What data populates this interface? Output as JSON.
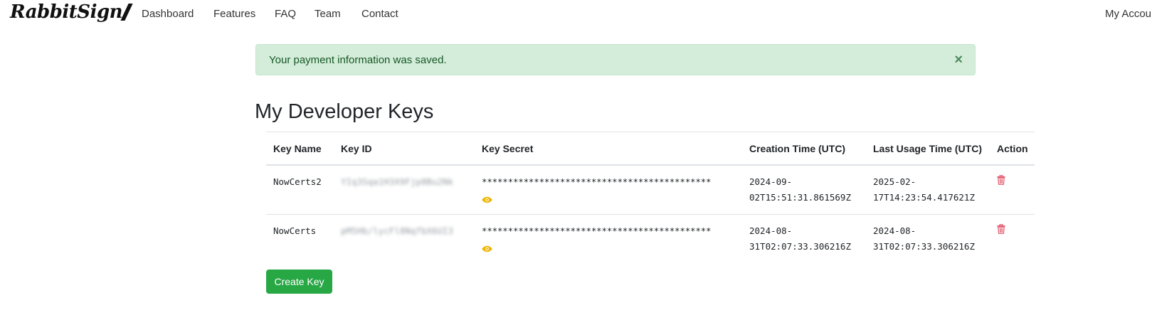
{
  "nav": {
    "brand": "RabbitSign",
    "links": [
      "Dashboard",
      "Features",
      "FAQ",
      "Team",
      "Contact"
    ],
    "account": "My Account"
  },
  "alert": {
    "message": "Your payment information was saved.",
    "close": "×",
    "colors": {
      "background": "#d4edda",
      "text": "#155724"
    }
  },
  "page": {
    "title": "My Developer Keys"
  },
  "table": {
    "headers": [
      "Key Name",
      "Key ID",
      "Key Secret",
      "Creation Time (UTC)",
      "Last Usage Time (UTC)",
      "Action"
    ],
    "rows": [
      {
        "name": "NowCerts2",
        "key_id": "YIq3Sqa1H3X9Fjp8Bu2Nk",
        "secret": "********************************************",
        "reveal_icon": "eye-icon",
        "created_line1": "2024-09-",
        "created_line2": "02T15:51:31.861569Z",
        "last_used_line1": "2025-02-",
        "last_used_line2": "17T14:23:54.417621Z",
        "action_icon": "trash-icon"
      },
      {
        "name": "NowCerts",
        "key_id": "pM5Hb/lycFl8NqfbX6UI3",
        "secret": "********************************************",
        "reveal_icon": "eye-icon",
        "created_line1": "2024-08-",
        "created_line2": "31T02:07:33.306216Z",
        "last_used_line1": "2024-08-",
        "last_used_line2": "31T02:07:33.306216Z",
        "action_icon": "trash-icon"
      }
    ]
  },
  "actions": {
    "create_key": "Create Key"
  },
  "colors": {
    "primary_button": "#28a745",
    "eye_icon": "#f0b400",
    "delete_icon": "#dc3545"
  }
}
